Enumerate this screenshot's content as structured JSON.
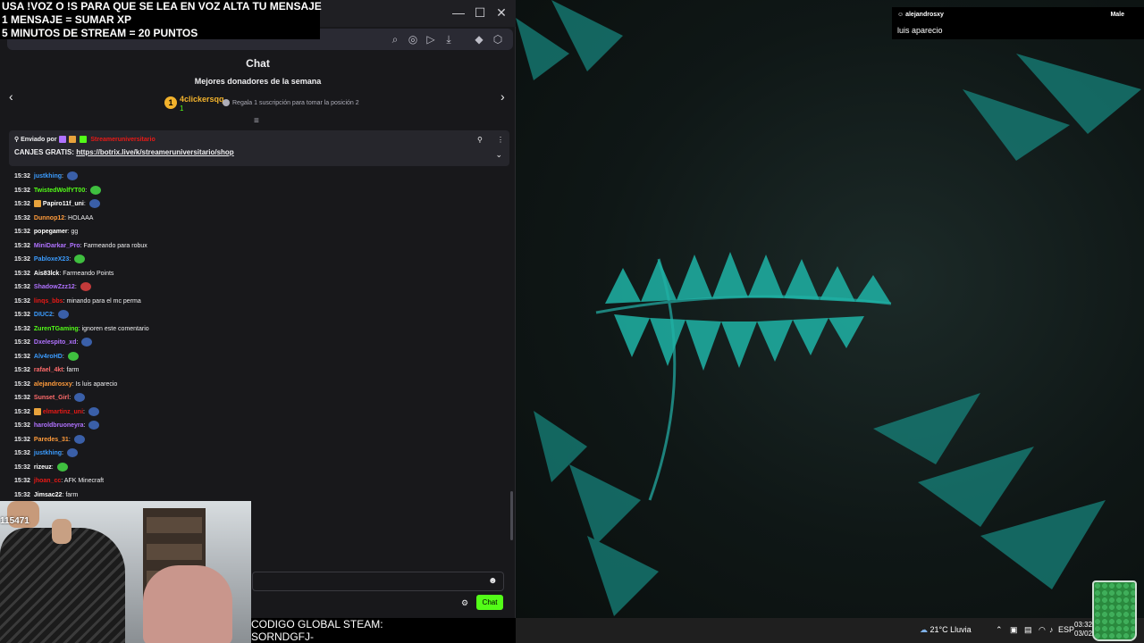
{
  "overlay": {
    "line1": "USA !VOZ O !S PARA QUE SE LEA EN VOZ ALTA TU MENSAJE",
    "line2": "1 MENSAJE = SUMAR XP",
    "line3": "5 MINUTOS DE STREAM = 20 PUNTOS"
  },
  "window": {
    "minimize": "—",
    "maximize": "☐",
    "close": "✕"
  },
  "chat": {
    "title": "Chat",
    "donors_title": "Mejores donadores de la semana",
    "donor_rank": "1",
    "donor_name": "4clickersqq",
    "donor_count": "1",
    "donor_hint": "Regala 1 suscripción para tomar la posición 2"
  },
  "pinned": {
    "by_label": "Enviado por",
    "by_user": "Streameruniversitario",
    "message_prefix": "CANJES GRATIS: ",
    "link": "https://botrix.live/k/streameruniversitario/shop"
  },
  "messages": [
    {
      "time": "15:32",
      "user": "justkhing",
      "color": "#3b9cff",
      "text": "",
      "emote": "#3a5fa8"
    },
    {
      "time": "15:32",
      "user": "TwistedWolfYT00",
      "color": "#53fc18",
      "text": "",
      "emote": "#3fbf3f"
    },
    {
      "time": "15:32",
      "user": "Papiro11f_uni",
      "color": "#ffffff",
      "text": "",
      "emote": "#3a5fa8",
      "badge": true
    },
    {
      "time": "15:32",
      "user": "Dunnop12",
      "color": "#ff9b3b",
      "text": "HOLAAA"
    },
    {
      "time": "15:32",
      "user": "popegamer",
      "color": "#ffffff",
      "text": "gg"
    },
    {
      "time": "15:32",
      "user": "MiniDarkar_Pro",
      "color": "#b072ff",
      "text": "Farmeando para robux"
    },
    {
      "time": "15:32",
      "user": "PabloxeX23",
      "color": "#3b9cff",
      "text": "",
      "emote": "#3fbf3f"
    },
    {
      "time": "15:32",
      "user": "Ais83lck",
      "color": "#ffffff",
      "text": "Farmeando Points"
    },
    {
      "time": "15:32",
      "user": "ShadowZzz12",
      "color": "#b072ff",
      "text": "",
      "emote": "#c23a3a"
    },
    {
      "time": "15:32",
      "user": "linqs_bbs",
      "color": "#e91916",
      "text": "minando para el mc perma"
    },
    {
      "time": "15:32",
      "user": "DIUC2",
      "color": "#3b9cff",
      "text": "",
      "emote": "#3a5fa8"
    },
    {
      "time": "15:32",
      "user": "ZurenTGaming",
      "color": "#53fc18",
      "text": "ignoren este comentario"
    },
    {
      "time": "15:32",
      "user": "Dxelespito_xd",
      "color": "#b072ff",
      "text": "",
      "emote": "#3a5fa8"
    },
    {
      "time": "15:32",
      "user": "Alv4roHD",
      "color": "#3b9cff",
      "text": "",
      "emote": "#3fbf3f"
    },
    {
      "time": "15:32",
      "user": "rafael_4kt",
      "color": "#ff6b6b",
      "text": "farm"
    },
    {
      "time": "15:32",
      "user": "alejandrosxy",
      "color": "#ff9b3b",
      "text": "Is luis aparecio"
    },
    {
      "time": "15:32",
      "user": "Sunset_Girl",
      "color": "#ff6b6b",
      "text": "",
      "emote": "#3a5fa8"
    },
    {
      "time": "15:32",
      "user": "elmartinz_uni",
      "color": "#e91916",
      "text": "",
      "emote": "#3a5fa8",
      "badge": true
    },
    {
      "time": "15:32",
      "user": "haroldbruoneyra",
      "color": "#b072ff",
      "text": "",
      "emote": "#3a5fa8"
    },
    {
      "time": "15:32",
      "user": "Paredes_31",
      "color": "#ff9b3b",
      "text": "",
      "emote": "#3a5fa8"
    },
    {
      "time": "15:32",
      "user": "justkhing",
      "color": "#3b9cff",
      "text": "",
      "emote": "#3a5fa8"
    },
    {
      "time": "15:32",
      "user": "rizeuz",
      "color": "#ffffff",
      "text": "",
      "emote": "#3fbf3f"
    },
    {
      "time": "15:32",
      "user": "jhoan_cc",
      "color": "#e91916",
      "text": "AFK Minecraft"
    },
    {
      "time": "15:32",
      "user": "Jimsac22",
      "color": "#ffffff",
      "text": "farm"
    }
  ],
  "input": {
    "send_label": "Chat"
  },
  "webcam": {
    "id_label": "115471"
  },
  "code": {
    "line1": "CODIGO GLOBAL STEAM:",
    "line2": "SORNDGFJ-"
  },
  "notification": {
    "user": "alejandrosxy",
    "tag": "Male",
    "message": "luis aparecio"
  },
  "taskbar": {
    "weather": "21°C  Lluvia",
    "lang": "ESP",
    "time": "03:32",
    "date": "03/02/"
  },
  "colors": {
    "kick_green": "#53fc18",
    "chat_bg": "#18181b"
  }
}
